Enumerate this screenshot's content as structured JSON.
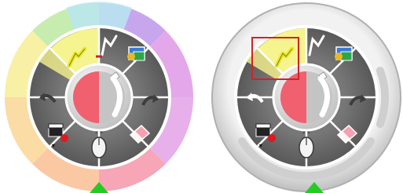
{
  "dials": [
    {
      "id": "colored-rim",
      "rim": "colored",
      "selected_tool": "pen",
      "highlighted": false,
      "rim_colors": [
        "#fbc8a4",
        "#f6a6b6",
        "#e4a8ea",
        "#c7a6ee",
        "#c8c4f4",
        "#b8e6f0",
        "#c6ecb0",
        "#f8f0a4"
      ]
    },
    {
      "id": "grey-rim",
      "rim": "grey",
      "selected_tool": "pen",
      "highlighted": true,
      "rim_colors": []
    }
  ],
  "tools": [
    {
      "name": "pen",
      "icon": "pen-icon"
    },
    {
      "name": "pointer",
      "icon": "pointer-pen-icon"
    },
    {
      "name": "capture",
      "icon": "screen-capture-icon"
    },
    {
      "name": "redo",
      "icon": "redo-icon"
    },
    {
      "name": "eraser",
      "icon": "eraser-icon"
    },
    {
      "name": "mouse",
      "icon": "mouse-icon"
    },
    {
      "name": "recorder",
      "icon": "recorder-icon"
    },
    {
      "name": "undo",
      "icon": "undo-icon"
    }
  ],
  "center": {
    "left_color": "#f0606e",
    "right_color": "#c4c4c4",
    "icon": "pen-nib-icon"
  },
  "colors": {
    "segment": "#6e6e6e",
    "segment_dark": "#4a4a4a",
    "selected_segment": "#f6f48e",
    "highlight_border": "#d42127",
    "indicator": "#22cc22"
  }
}
